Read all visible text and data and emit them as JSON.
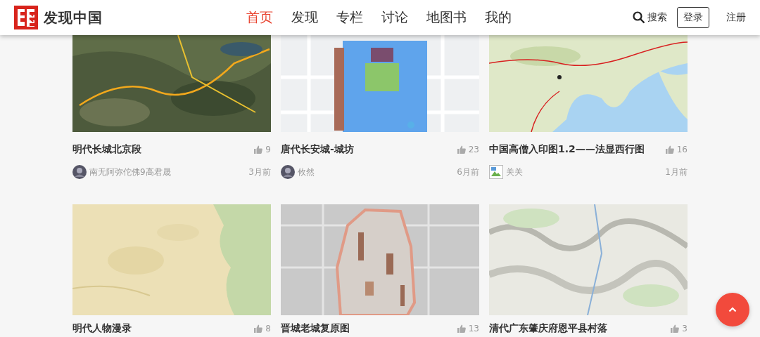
{
  "header": {
    "logo_text": "发现中国",
    "nav": [
      {
        "label": "首页",
        "selected": true
      },
      {
        "label": "发现",
        "selected": false
      },
      {
        "label": "专栏",
        "selected": false
      },
      {
        "label": "讨论",
        "selected": false
      },
      {
        "label": "地图书",
        "selected": false
      },
      {
        "label": "我的",
        "selected": false
      }
    ],
    "search_label": "搜索",
    "login": "登录",
    "register": "注册"
  },
  "cards": [
    {
      "title": "明代长城北京段",
      "likes": "9",
      "author": {
        "name": "南无阿弥佗佛9高君晟"
      },
      "time": "3月前"
    },
    {
      "title": "唐代长安城-城坊",
      "likes": "23",
      "author": {
        "name": "攸然"
      },
      "time": "6月前"
    },
    {
      "title": "中国高僧入印图1.2——法显西行图",
      "likes": "16",
      "author": {
        "name": "关关",
        "avatar": {
          "kind": "broken"
        }
      },
      "time": "1月前"
    },
    {
      "title": "明代人物漫录",
      "likes": "8"
    },
    {
      "title": "晋城老城复原图",
      "likes": "13"
    },
    {
      "title": "清代广东肇庆府恩平县村落",
      "likes": "3"
    }
  ]
}
